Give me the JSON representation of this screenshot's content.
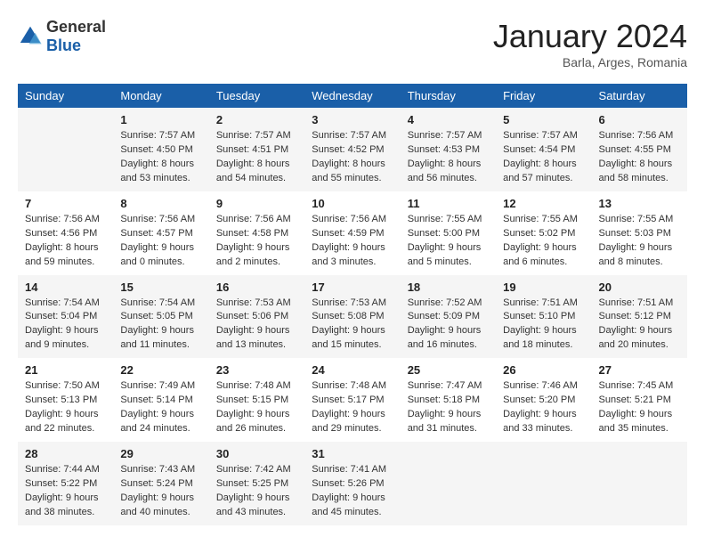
{
  "header": {
    "logo_general": "General",
    "logo_blue": "Blue",
    "month_title": "January 2024",
    "subtitle": "Barla, Arges, Romania"
  },
  "weekdays": [
    "Sunday",
    "Monday",
    "Tuesday",
    "Wednesday",
    "Thursday",
    "Friday",
    "Saturday"
  ],
  "weeks": [
    [
      {
        "day": "",
        "info": ""
      },
      {
        "day": "1",
        "info": "Sunrise: 7:57 AM\nSunset: 4:50 PM\nDaylight: 8 hours\nand 53 minutes."
      },
      {
        "day": "2",
        "info": "Sunrise: 7:57 AM\nSunset: 4:51 PM\nDaylight: 8 hours\nand 54 minutes."
      },
      {
        "day": "3",
        "info": "Sunrise: 7:57 AM\nSunset: 4:52 PM\nDaylight: 8 hours\nand 55 minutes."
      },
      {
        "day": "4",
        "info": "Sunrise: 7:57 AM\nSunset: 4:53 PM\nDaylight: 8 hours\nand 56 minutes."
      },
      {
        "day": "5",
        "info": "Sunrise: 7:57 AM\nSunset: 4:54 PM\nDaylight: 8 hours\nand 57 minutes."
      },
      {
        "day": "6",
        "info": "Sunrise: 7:56 AM\nSunset: 4:55 PM\nDaylight: 8 hours\nand 58 minutes."
      }
    ],
    [
      {
        "day": "7",
        "info": "Sunrise: 7:56 AM\nSunset: 4:56 PM\nDaylight: 8 hours\nand 59 minutes."
      },
      {
        "day": "8",
        "info": "Sunrise: 7:56 AM\nSunset: 4:57 PM\nDaylight: 9 hours\nand 0 minutes."
      },
      {
        "day": "9",
        "info": "Sunrise: 7:56 AM\nSunset: 4:58 PM\nDaylight: 9 hours\nand 2 minutes."
      },
      {
        "day": "10",
        "info": "Sunrise: 7:56 AM\nSunset: 4:59 PM\nDaylight: 9 hours\nand 3 minutes."
      },
      {
        "day": "11",
        "info": "Sunrise: 7:55 AM\nSunset: 5:00 PM\nDaylight: 9 hours\nand 5 minutes."
      },
      {
        "day": "12",
        "info": "Sunrise: 7:55 AM\nSunset: 5:02 PM\nDaylight: 9 hours\nand 6 minutes."
      },
      {
        "day": "13",
        "info": "Sunrise: 7:55 AM\nSunset: 5:03 PM\nDaylight: 9 hours\nand 8 minutes."
      }
    ],
    [
      {
        "day": "14",
        "info": "Sunrise: 7:54 AM\nSunset: 5:04 PM\nDaylight: 9 hours\nand 9 minutes."
      },
      {
        "day": "15",
        "info": "Sunrise: 7:54 AM\nSunset: 5:05 PM\nDaylight: 9 hours\nand 11 minutes."
      },
      {
        "day": "16",
        "info": "Sunrise: 7:53 AM\nSunset: 5:06 PM\nDaylight: 9 hours\nand 13 minutes."
      },
      {
        "day": "17",
        "info": "Sunrise: 7:53 AM\nSunset: 5:08 PM\nDaylight: 9 hours\nand 15 minutes."
      },
      {
        "day": "18",
        "info": "Sunrise: 7:52 AM\nSunset: 5:09 PM\nDaylight: 9 hours\nand 16 minutes."
      },
      {
        "day": "19",
        "info": "Sunrise: 7:51 AM\nSunset: 5:10 PM\nDaylight: 9 hours\nand 18 minutes."
      },
      {
        "day": "20",
        "info": "Sunrise: 7:51 AM\nSunset: 5:12 PM\nDaylight: 9 hours\nand 20 minutes."
      }
    ],
    [
      {
        "day": "21",
        "info": "Sunrise: 7:50 AM\nSunset: 5:13 PM\nDaylight: 9 hours\nand 22 minutes."
      },
      {
        "day": "22",
        "info": "Sunrise: 7:49 AM\nSunset: 5:14 PM\nDaylight: 9 hours\nand 24 minutes."
      },
      {
        "day": "23",
        "info": "Sunrise: 7:48 AM\nSunset: 5:15 PM\nDaylight: 9 hours\nand 26 minutes."
      },
      {
        "day": "24",
        "info": "Sunrise: 7:48 AM\nSunset: 5:17 PM\nDaylight: 9 hours\nand 29 minutes."
      },
      {
        "day": "25",
        "info": "Sunrise: 7:47 AM\nSunset: 5:18 PM\nDaylight: 9 hours\nand 31 minutes."
      },
      {
        "day": "26",
        "info": "Sunrise: 7:46 AM\nSunset: 5:20 PM\nDaylight: 9 hours\nand 33 minutes."
      },
      {
        "day": "27",
        "info": "Sunrise: 7:45 AM\nSunset: 5:21 PM\nDaylight: 9 hours\nand 35 minutes."
      }
    ],
    [
      {
        "day": "28",
        "info": "Sunrise: 7:44 AM\nSunset: 5:22 PM\nDaylight: 9 hours\nand 38 minutes."
      },
      {
        "day": "29",
        "info": "Sunrise: 7:43 AM\nSunset: 5:24 PM\nDaylight: 9 hours\nand 40 minutes."
      },
      {
        "day": "30",
        "info": "Sunrise: 7:42 AM\nSunset: 5:25 PM\nDaylight: 9 hours\nand 43 minutes."
      },
      {
        "day": "31",
        "info": "Sunrise: 7:41 AM\nSunset: 5:26 PM\nDaylight: 9 hours\nand 45 minutes."
      },
      {
        "day": "",
        "info": ""
      },
      {
        "day": "",
        "info": ""
      },
      {
        "day": "",
        "info": ""
      }
    ]
  ]
}
